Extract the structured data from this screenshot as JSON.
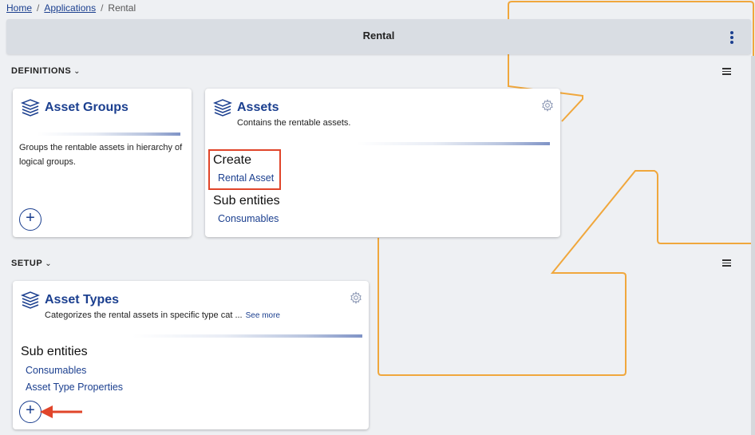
{
  "breadcrumb": {
    "home": "Home",
    "applications": "Applications",
    "separator": "/",
    "current": "Rental"
  },
  "header": {
    "title": "Rental"
  },
  "sections": {
    "definitions": {
      "label": "DEFINITIONS",
      "chevron": "⌄"
    },
    "setup": {
      "label": "SETUP",
      "chevron": "⌄"
    }
  },
  "cards": {
    "asset_groups": {
      "title": "Asset Groups",
      "description": "Groups the rentable assets in hierarchy of logical groups.",
      "add_label": "+"
    },
    "assets": {
      "title": "Assets",
      "description": "Contains the rentable assets.",
      "create_heading": "Create",
      "create_link": "Rental Asset",
      "sub_heading": "Sub entities",
      "sub_links": [
        "Consumables"
      ]
    },
    "asset_types": {
      "title": "Asset Types",
      "description": "Categorizes the rental assets in specific type cat ...",
      "see_more": "See more",
      "sub_heading": "Sub entities",
      "sub_links": [
        "Consumables",
        "Asset Type Properties"
      ],
      "add_label": "+"
    }
  },
  "colors": {
    "accent": "#1b3f8f",
    "annotation_orange": "#f0a73c",
    "annotation_red": "#e0452a",
    "background": "#eef0f3"
  },
  "icons": [
    "stack-icon",
    "gear-icon",
    "kebab-menu-icon",
    "hamburger-menu-icon",
    "plus-icon",
    "arrow-icon"
  ]
}
